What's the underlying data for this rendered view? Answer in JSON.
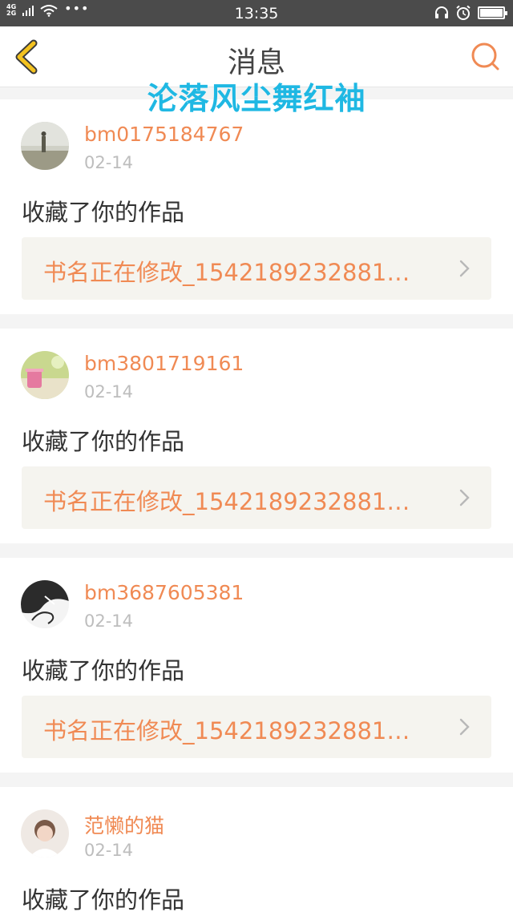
{
  "status_bar": {
    "net_4g": "4G",
    "net_2g": "2G",
    "dots": "•••",
    "time": "13:35"
  },
  "nav": {
    "title": "消息"
  },
  "watermark": "沦落风尘舞红袖",
  "messages": [
    {
      "username": "bm0175184767",
      "date": "02-14",
      "action": "收藏了你的作品",
      "book_title": "书名正在修改_1542189232881…"
    },
    {
      "username": "bm3801719161",
      "date": "02-14",
      "action": "收藏了你的作品",
      "book_title": "书名正在修改_1542189232881…"
    },
    {
      "username": "bm3687605381",
      "date": "02-14",
      "action": "收藏了你的作品",
      "book_title": "书名正在修改_1542189232881…"
    },
    {
      "username": "范懒的猫",
      "date": "02-14",
      "action": "收藏了你的作品"
    }
  ],
  "colors": {
    "accent": "#f08a54",
    "watermark": "#1fb8e3",
    "back_icon": "#f3c21f"
  }
}
